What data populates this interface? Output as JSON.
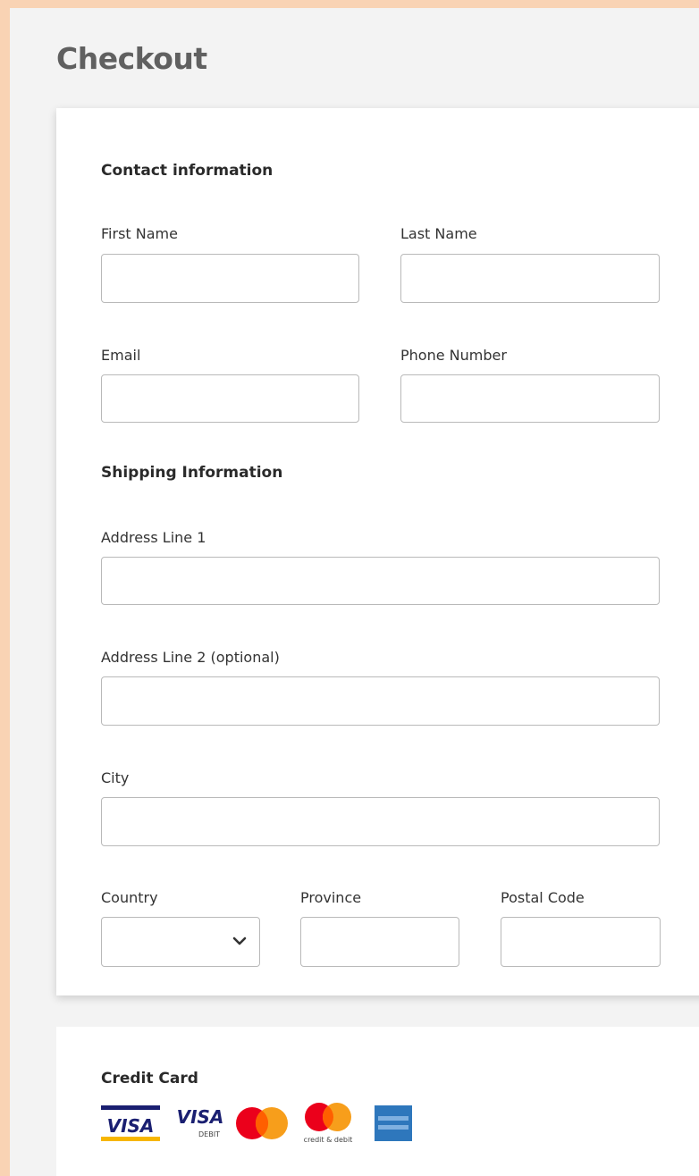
{
  "page": {
    "title": "Checkout"
  },
  "contact": {
    "heading": "Contact information",
    "first_name": {
      "label": "First Name",
      "value": "",
      "placeholder": ""
    },
    "last_name": {
      "label": "Last Name",
      "value": "",
      "placeholder": ""
    },
    "email": {
      "label": "Email",
      "value": "",
      "placeholder": ""
    },
    "phone": {
      "label": "Phone Number",
      "value": "",
      "placeholder": ""
    }
  },
  "shipping": {
    "heading": "Shipping Information",
    "address1": {
      "label": "Address Line 1",
      "value": "",
      "placeholder": ""
    },
    "address2": {
      "label": "Address Line 2 (optional)",
      "value": "",
      "placeholder": ""
    },
    "city": {
      "label": "City",
      "value": "",
      "placeholder": ""
    },
    "country": {
      "label": "Country",
      "selected": ""
    },
    "province": {
      "label": "Province",
      "value": "",
      "placeholder": ""
    },
    "postal_code": {
      "label": "Postal Code",
      "value": "",
      "placeholder": ""
    }
  },
  "payment": {
    "heading": "Credit Card",
    "logos": {
      "visa": "VISA",
      "visa_debit": "VISA",
      "visa_debit_caption": "DEBIT",
      "mastercard_debit_caption": "credit & debit"
    }
  },
  "colors": {
    "frame_border": "#f9d3b4",
    "page_background": "#f3f3f3",
    "title": "#606060",
    "input_border": "#b9b9b9",
    "visa_blue": "#1a1f71",
    "visa_gold": "#f7b600",
    "mastercard_red": "#eb001b",
    "mastercard_orange": "#f79e1b",
    "amex_blue": "#2e77bc"
  },
  "icons": {
    "country_select": "chevron-down-icon"
  }
}
